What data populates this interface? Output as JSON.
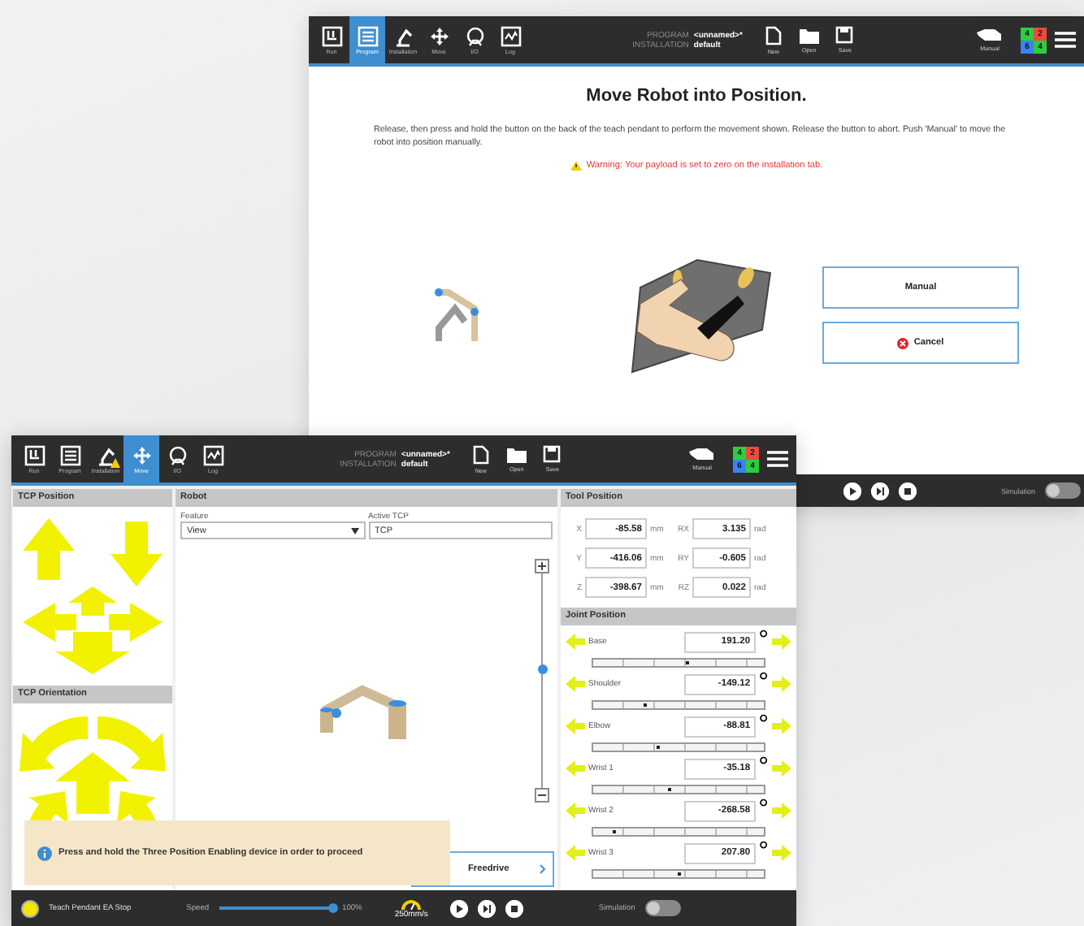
{
  "back_window": {
    "header": {
      "nav": [
        {
          "kind": "run",
          "label": "Run",
          "selected": false,
          "warning": false
        },
        {
          "kind": "program",
          "label": "Program",
          "selected": true,
          "warning": false
        },
        {
          "kind": "installation",
          "label": "Installation",
          "selected": false,
          "warning": false
        },
        {
          "kind": "move",
          "label": "Move",
          "selected": false,
          "warning": false
        },
        {
          "kind": "io",
          "label": "I/O",
          "selected": false,
          "warning": false
        },
        {
          "kind": "log",
          "label": "Log",
          "selected": false,
          "warning": false
        }
      ],
      "program_label": "PROGRAM",
      "program_name": "<unnamed>*",
      "installation_label": "INSTALLATION",
      "installation_name": "default",
      "file_buttons": [
        {
          "kind": "new",
          "label": "New"
        },
        {
          "kind": "open",
          "label": "Open"
        },
        {
          "kind": "save",
          "label": "Save"
        }
      ],
      "mode": "Manual",
      "io_counts": [
        {
          "text": "4",
          "color": "#2ecc40"
        },
        {
          "text": "2",
          "color": "#e74c3c"
        },
        {
          "text": "6",
          "color": "#3b82f6"
        },
        {
          "text": "4",
          "color": "#2ecc40"
        }
      ]
    },
    "title": "Move Robot into Position.",
    "message": "Release, then press and hold the button on the back of the teach pendant to perform the movement shown. Release the button to abort. Push 'Manual' to move the robot into position manually.",
    "warning": "Warning: Your payload is set to zero on the installation tab.",
    "buttons": [
      {
        "kind": "manual",
        "label": "Manual"
      },
      {
        "kind": "cancel",
        "label": "Cancel"
      }
    ],
    "footer": {
      "simulation_label": "Simulation",
      "simulation_on": false
    }
  },
  "front_window": {
    "header": {
      "nav": [
        {
          "kind": "run",
          "label": "Run",
          "selected": false,
          "warning": false
        },
        {
          "kind": "program",
          "label": "Program",
          "selected": false,
          "warning": false
        },
        {
          "kind": "installation",
          "label": "Installation",
          "selected": false,
          "warning": true
        },
        {
          "kind": "move",
          "label": "Move",
          "selected": true,
          "warning": false
        },
        {
          "kind": "io",
          "label": "I/O",
          "selected": false,
          "warning": false
        },
        {
          "kind": "log",
          "label": "Log",
          "selected": false,
          "warning": false
        }
      ],
      "program_label": "PROGRAM",
      "program_name": "<unnamed>*",
      "installation_label": "INSTALLATION",
      "installation_name": "default",
      "file_buttons": [
        {
          "kind": "new",
          "label": "New"
        },
        {
          "kind": "open",
          "label": "Open"
        },
        {
          "kind": "save",
          "label": "Save"
        }
      ],
      "mode": "Manual",
      "io_counts": [
        {
          "text": "4",
          "color": "#2ecc40"
        },
        {
          "text": "2",
          "color": "#e74c3c"
        },
        {
          "text": "6",
          "color": "#3b82f6"
        },
        {
          "text": "4",
          "color": "#2ecc40"
        }
      ]
    },
    "tcp_position_title": "TCP Position",
    "tcp_orientation_title": "TCP Orientation",
    "robot_panel": {
      "title": "Robot",
      "feature_label": "Feature",
      "feature_value": "View",
      "active_tcp_label": "Active TCP",
      "active_tcp_value": "TCP",
      "zoom": {
        "level": 0.55
      },
      "freedrive_label": "Freedrive"
    },
    "tool_position": {
      "title": "Tool Position",
      "rows": [
        {
          "label": "X",
          "value": "-85.58",
          "unit": "mm",
          "rot_label": "RX",
          "rot_value": "3.135",
          "rot_unit": "rad"
        },
        {
          "label": "Y",
          "value": "-416.06",
          "unit": "mm",
          "rot_label": "RY",
          "rot_value": "-0.605",
          "rot_unit": "rad"
        },
        {
          "label": "Z",
          "value": "-398.67",
          "unit": "mm",
          "rot_label": "RZ",
          "rot_value": "0.022",
          "rot_unit": "rad"
        }
      ]
    },
    "joint_position": {
      "title": "Joint Position",
      "joints": [
        {
          "name": "Base",
          "value": "191.20",
          "unit": "°",
          "level": 0.55
        },
        {
          "name": "Shoulder",
          "value": "-149.12",
          "unit": "°",
          "level": 0.3
        },
        {
          "name": "Elbow",
          "value": "-88.81",
          "unit": "°",
          "level": 0.38
        },
        {
          "name": "Wrist 1",
          "value": "-35.18",
          "unit": "°",
          "level": 0.45
        },
        {
          "name": "Wrist 2",
          "value": "-268.58",
          "unit": "°",
          "level": 0.12
        },
        {
          "name": "Wrist 3",
          "value": "207.80",
          "unit": "°",
          "level": 0.5
        }
      ]
    },
    "toast": "Press and hold the Three Position Enabling device in order to proceed",
    "footer": {
      "status": "Teach Pendant EA Stop",
      "speed_label": "Speed",
      "speed": {
        "level": 1
      },
      "speed_text": "100%",
      "tcp_speed": "250mm/s",
      "simulation_label": "Simulation",
      "simulation_on": false
    }
  }
}
